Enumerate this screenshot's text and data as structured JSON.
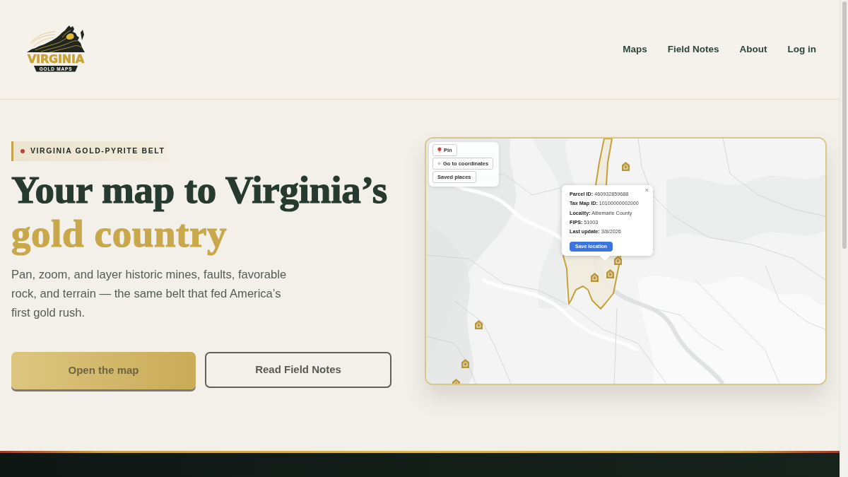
{
  "header": {
    "logo": {
      "title": "VIRGINIA",
      "subtitle": "GOLD MAPS"
    },
    "nav": [
      "Maps",
      "Field Notes",
      "About",
      "Log in"
    ]
  },
  "hero": {
    "badge": "VIRGINIA GOLD-PYRITE BELT",
    "heading": "Your map to Virginia’s",
    "heading_highlight": "gold country",
    "description": "Pan, zoom, and layer historic mines, faults, favorable rock, and terrain — the same belt that fed America’s first gold rush.",
    "buttons": [
      {
        "label": "Open the map",
        "kind": "primary"
      },
      {
        "label": "Read Field Notes",
        "kind": "outline"
      }
    ]
  },
  "map": {
    "tools": [
      {
        "label": "Pin",
        "kind": "pin"
      },
      {
        "label": "Go to coordinates",
        "kind": "coordinates"
      },
      {
        "label": "Saved places",
        "kind": "plain"
      }
    ],
    "popup": {
      "close": "×",
      "fields": [
        {
          "label": "Parcel ID:",
          "value": "460932859688"
        },
        {
          "label": "Tax Map ID:",
          "value": "10100000002000"
        },
        {
          "label": "Locality:",
          "value": "Albemarle County"
        },
        {
          "label": "FIPS:",
          "value": "51003"
        },
        {
          "label": "Last update:",
          "value": "3/8/2026"
        }
      ],
      "button": "Save location"
    }
  }
}
